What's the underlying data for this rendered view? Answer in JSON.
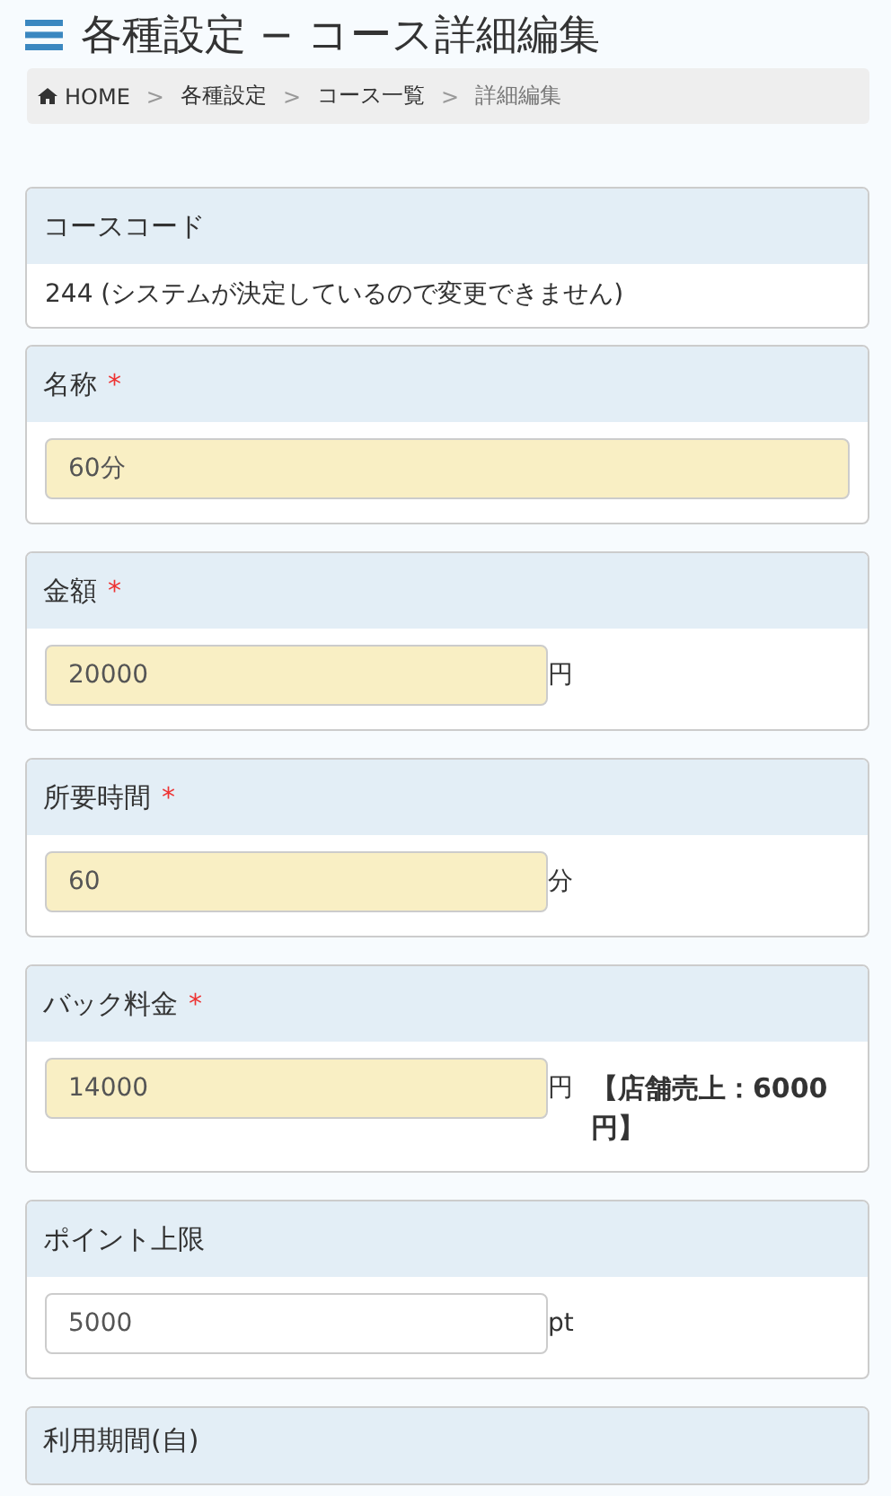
{
  "page_title": "各種設定 − コース詳細編集",
  "breadcrumb": {
    "separator": ">",
    "items": [
      {
        "label": "HOME",
        "current": false
      },
      {
        "label": "各種設定",
        "current": false
      },
      {
        "label": "コース一覧",
        "current": false
      },
      {
        "label": "詳細編集",
        "current": true
      }
    ]
  },
  "fields": [
    {
      "kind": "static",
      "label": "コースコード",
      "value": "244 (システムが決定しているので変更できません)"
    },
    {
      "kind": "input",
      "label": "名称",
      "required_mark": "*",
      "value": "60分",
      "highlighted": true
    },
    {
      "kind": "input",
      "label": "金額",
      "required_mark": "*",
      "value": "20000",
      "highlighted": true,
      "unit": "円"
    },
    {
      "kind": "input",
      "label": "所要時間",
      "required_mark": "*",
      "value": "60",
      "highlighted": true,
      "unit": "分"
    },
    {
      "kind": "input",
      "label": "バック料金",
      "required_mark": "*",
      "value": "14000",
      "highlighted": true,
      "unit": "円",
      "note": "【店舗売上：6000円】"
    },
    {
      "kind": "input",
      "label": "ポイント上限",
      "value": "5000",
      "highlighted": false,
      "unit": "pt"
    },
    {
      "kind": "heading",
      "label": "利用期間(自)"
    }
  ]
}
